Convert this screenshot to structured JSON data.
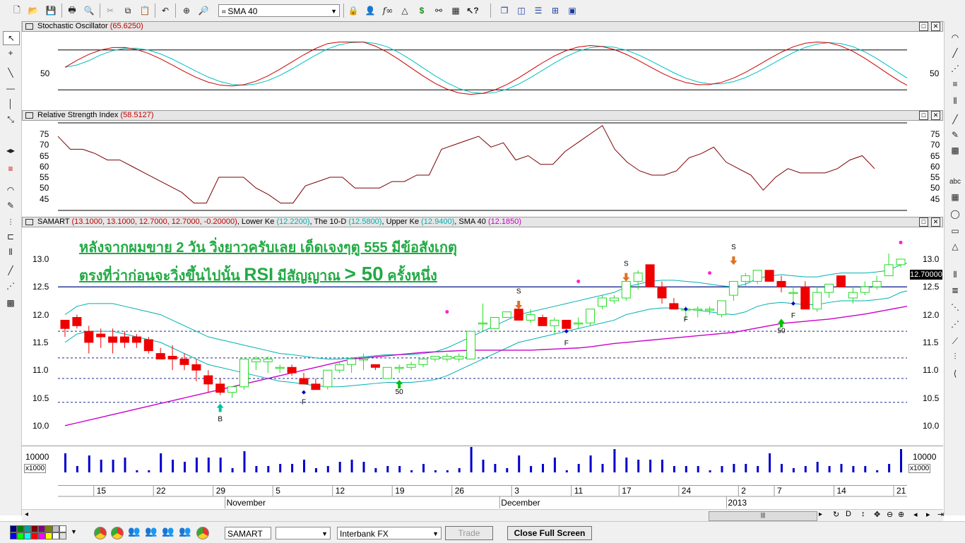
{
  "toolbar": {
    "indicator_select": "SMA 40",
    "icons": [
      "new-icon",
      "open-icon",
      "save-icon",
      "print-icon",
      "print-preview-icon",
      "cut-icon",
      "copy-icon",
      "paste-icon",
      "undo-icon",
      "crosshair-icon",
      "zoom-icon",
      "lock-icon",
      "person-icon",
      "function-icon",
      "triangle-icon",
      "dollar-icon",
      "binoculars-icon",
      "chart-settings-icon",
      "help-icon",
      "window-icon",
      "tile-vertical-icon",
      "tile-horizontal-icon",
      "tile-grid-icon",
      "layout-icon"
    ]
  },
  "stochastic": {
    "title": "Stochastic Oscillator",
    "value": "(65.6250)",
    "axis_label": "50"
  },
  "rsi": {
    "title": "Relative Strength Index",
    "value": "(58.5127)",
    "ticks": [
      "75",
      "70",
      "65",
      "60",
      "55",
      "50",
      "45"
    ],
    "values": [
      74,
      68,
      68,
      66,
      63,
      63,
      60,
      57,
      54,
      51,
      48,
      43,
      43,
      55,
      55,
      55,
      50,
      47,
      43,
      43,
      51,
      53,
      55,
      55,
      50,
      50,
      50,
      53,
      53,
      56,
      56,
      68,
      70,
      72,
      74,
      69,
      71,
      63,
      65,
      61,
      61,
      67,
      71,
      75,
      79,
      68,
      62,
      58,
      56,
      56,
      58,
      64,
      66,
      69,
      62,
      59,
      56,
      49,
      55,
      59,
      57,
      57,
      57,
      59,
      63,
      65,
      59
    ]
  },
  "price": {
    "title": "SAMART",
    "ohlc": "(13.1000, 13.1000, 12.7000, 12.7000, -0.20000)",
    "lower_label": "Lower Ke",
    "lower_value": "(12.2200)",
    "tend_label": "The 10-D",
    "tend_value": "(12.5800)",
    "upper_label": "Upper Ke",
    "upper_value": "(12.9400)",
    "sma_label": "SMA 40",
    "sma_value": "(12.1850)",
    "annotation_line1": "หลังจากผมขาย 2 วัน วิ่งยาวครับเลย เด็ดเจงๆตู 555 มีข้อสังเกตุ",
    "annotation_line2_prefix": "ตรงที่ว่าก่อนจะวิ่งขึ้นไปนั้น ",
    "annotation_line2_rsi": "RSI",
    "annotation_line2_middle": " มีสัญญาณ ",
    "annotation_line2_big": "> 50",
    "annotation_line2_suffix": " ครั้งหนึ่ง",
    "price_ticks": [
      "13.0",
      "12.5",
      "12.0",
      "11.5",
      "11.0",
      "10.5",
      "10.0"
    ],
    "last_price": "12.70000",
    "marker_labels": {
      "b": "B",
      "f": "F",
      "s": "S",
      "fifty": "50"
    },
    "candles": [
      [
        11.9,
        11.9,
        11.6,
        11.75
      ],
      [
        11.95,
        12.0,
        11.75,
        11.8
      ],
      [
        11.7,
        11.8,
        11.3,
        11.5
      ],
      [
        11.65,
        11.75,
        11.4,
        11.6
      ],
      [
        11.6,
        11.75,
        11.3,
        11.5
      ],
      [
        11.6,
        11.7,
        11.4,
        11.5
      ],
      [
        11.6,
        11.65,
        11.4,
        11.5
      ],
      [
        11.55,
        11.6,
        11.3,
        11.35
      ],
      [
        11.3,
        11.4,
        11.2,
        11.2
      ],
      [
        11.25,
        11.45,
        11.0,
        11.2
      ],
      [
        11.2,
        11.3,
        11.0,
        11.1
      ],
      [
        11.1,
        11.2,
        10.8,
        11.0
      ],
      [
        10.9,
        11.0,
        10.6,
        10.75
      ],
      [
        10.75,
        10.85,
        10.55,
        10.6
      ],
      [
        10.6,
        10.7,
        10.5,
        10.7
      ],
      [
        10.7,
        11.2,
        10.65,
        11.2
      ],
      [
        11.15,
        11.25,
        11.0,
        11.2
      ],
      [
        11.15,
        11.25,
        10.95,
        11.2
      ],
      [
        11.05,
        11.1,
        10.95,
        11.05
      ],
      [
        11.05,
        11.1,
        10.9,
        10.95
      ],
      [
        10.85,
        10.95,
        10.75,
        10.75
      ],
      [
        10.75,
        10.85,
        10.65,
        10.65
      ],
      [
        10.7,
        11.0,
        10.65,
        11.0
      ],
      [
        11.0,
        11.15,
        10.95,
        11.1
      ],
      [
        11.1,
        11.2,
        10.95,
        11.2
      ],
      [
        11.2,
        11.3,
        11.0,
        11.2
      ],
      [
        11.1,
        11.1,
        11.0,
        11.05
      ],
      [
        10.85,
        11.05,
        10.85,
        11.05
      ],
      [
        11.05,
        11.1,
        10.95,
        11.05
      ],
      [
        11.05,
        11.15,
        11.0,
        11.1
      ],
      [
        11.1,
        11.2,
        11.05,
        11.2
      ],
      [
        11.2,
        11.25,
        11.15,
        11.25
      ],
      [
        11.2,
        11.3,
        11.15,
        11.25
      ],
      [
        11.2,
        11.3,
        11.15,
        11.25
      ],
      [
        11.2,
        11.7,
        11.2,
        11.7
      ],
      [
        11.85,
        12.2,
        11.7,
        11.85
      ],
      [
        11.75,
        11.95,
        11.75,
        11.95
      ],
      [
        11.95,
        12.05,
        11.95,
        12.05
      ],
      [
        12.1,
        12.1,
        11.9,
        11.9
      ],
      [
        11.9,
        12.1,
        11.85,
        12.0
      ],
      [
        11.95,
        12.0,
        11.8,
        11.8
      ],
      [
        11.8,
        11.95,
        11.65,
        11.9
      ],
      [
        11.9,
        11.9,
        11.75,
        11.75
      ],
      [
        11.85,
        11.95,
        11.75,
        11.85
      ],
      [
        11.85,
        12.1,
        11.8,
        12.1
      ],
      [
        12.15,
        12.35,
        12.1,
        12.3
      ],
      [
        12.25,
        12.35,
        12.2,
        12.3
      ],
      [
        12.3,
        12.6,
        12.25,
        12.6
      ],
      [
        12.6,
        12.8,
        12.45,
        12.75
      ],
      [
        12.9,
        12.9,
        12.5,
        12.5
      ],
      [
        12.5,
        12.6,
        12.2,
        12.3
      ],
      [
        12.2,
        12.3,
        12.1,
        12.1
      ],
      [
        12.1,
        12.15,
        11.9,
        12.1
      ],
      [
        12.1,
        12.15,
        11.95,
        12.1
      ],
      [
        12.1,
        12.15,
        12.0,
        12.1
      ],
      [
        12.0,
        12.25,
        11.95,
        12.25
      ],
      [
        12.35,
        12.6,
        12.25,
        12.6
      ],
      [
        12.6,
        12.75,
        12.5,
        12.7
      ],
      [
        12.6,
        12.8,
        12.55,
        12.8
      ],
      [
        12.8,
        12.8,
        12.6,
        12.6
      ],
      [
        12.6,
        12.7,
        12.4,
        12.5
      ],
      [
        12.4,
        12.5,
        12.2,
        12.4
      ],
      [
        12.5,
        12.6,
        12.1,
        12.1
      ],
      [
        12.1,
        12.5,
        12.05,
        12.4
      ],
      [
        12.4,
        12.55,
        12.3,
        12.55
      ],
      [
        12.7,
        12.7,
        12.5,
        12.5
      ],
      [
        12.3,
        12.5,
        12.2,
        12.4
      ],
      [
        12.4,
        12.6,
        12.35,
        12.5
      ],
      [
        12.5,
        12.7,
        12.45,
        12.6
      ],
      [
        12.7,
        13.1,
        12.7,
        12.9
      ],
      [
        12.9,
        13.0,
        12.85,
        13.0
      ],
      [
        13.1,
        13.1,
        12.7,
        12.7
      ]
    ],
    "sma40": [
      10.0,
      10.05,
      10.1,
      10.15,
      10.2,
      10.25,
      10.3,
      10.35,
      10.4,
      10.45,
      10.5,
      10.55,
      10.6,
      10.65,
      10.7,
      10.75,
      10.8,
      10.85,
      10.9,
      10.95,
      11.0,
      11.05,
      11.1,
      11.15,
      11.2,
      11.22,
      11.24,
      11.26,
      11.28,
      11.3,
      11.32,
      11.33,
      11.34,
      11.35,
      11.36,
      11.36,
      11.36,
      11.36,
      11.36,
      11.36,
      11.37,
      11.38,
      11.39,
      11.4,
      11.42,
      11.45,
      11.48,
      11.5,
      11.52,
      11.54,
      11.56,
      11.58,
      11.6,
      11.62,
      11.64,
      11.66,
      11.68,
      11.72,
      11.76,
      11.8,
      11.84,
      11.86,
      11.88,
      11.9,
      11.92,
      11.95,
      11.98,
      12.01,
      12.05,
      12.09,
      12.13,
      12.17
    ],
    "upper": [
      12.0,
      12.15,
      12.2,
      12.2,
      12.2,
      12.15,
      12.1,
      12.05,
      12.0,
      11.9,
      11.8,
      11.7,
      11.6,
      11.55,
      11.5,
      11.45,
      11.4,
      11.35,
      11.3,
      11.28,
      11.25,
      11.22,
      11.2,
      11.2,
      11.22,
      11.24,
      11.26,
      11.28,
      11.28,
      11.28,
      11.3,
      11.33,
      11.4,
      11.5,
      11.6,
      11.7,
      11.8,
      11.9,
      12.0,
      12.05,
      12.1,
      12.15,
      12.2,
      12.25,
      12.3,
      12.35,
      12.4,
      12.5,
      12.55,
      12.6,
      12.62,
      12.62,
      12.6,
      12.58,
      12.55,
      12.52,
      12.5,
      12.55,
      12.65,
      12.7,
      12.72,
      12.7,
      12.68,
      12.68,
      12.72,
      12.75,
      12.75,
      12.75,
      12.77,
      12.8,
      12.9,
      12.95
    ],
    "lower": [
      11.5,
      11.65,
      11.7,
      11.7,
      11.7,
      11.65,
      11.6,
      11.55,
      11.5,
      11.4,
      11.3,
      11.2,
      11.1,
      11.05,
      11.0,
      10.95,
      10.9,
      10.85,
      10.8,
      10.78,
      10.75,
      10.72,
      10.7,
      10.7,
      10.72,
      10.74,
      10.76,
      10.78,
      10.78,
      10.78,
      10.8,
      10.83,
      10.9,
      11.0,
      11.1,
      11.2,
      11.3,
      11.4,
      11.5,
      11.55,
      11.6,
      11.65,
      11.7,
      11.75,
      11.8,
      11.85,
      11.9,
      12.0,
      12.05,
      12.1,
      12.12,
      12.12,
      12.1,
      12.08,
      12.05,
      12.02,
      12.0,
      12.05,
      12.15,
      12.2,
      12.22,
      12.2,
      12.18,
      12.18,
      12.22,
      12.25,
      12.25,
      12.25,
      12.27,
      12.3,
      12.4,
      12.45
    ],
    "hlines": [
      11.7,
      11.22,
      10.85,
      10.42
    ]
  },
  "volume": {
    "tick": "10000",
    "unit": "x1000",
    "values": [
      9,
      3,
      8,
      6,
      6,
      7,
      1,
      1,
      9,
      6,
      5,
      7,
      7,
      7,
      2,
      10,
      3,
      3,
      4,
      4,
      6,
      2,
      3,
      5,
      6,
      5,
      2,
      3,
      3,
      1,
      4,
      1,
      1,
      2,
      12,
      6,
      4,
      2,
      8,
      3,
      4,
      7,
      1,
      4,
      8,
      4,
      11,
      7,
      6,
      6,
      6,
      3,
      3,
      3,
      1,
      3,
      4,
      4,
      3,
      9,
      4,
      2,
      3,
      5,
      3,
      4,
      3,
      3,
      1,
      4,
      11,
      4,
      2
    ]
  },
  "dates": {
    "days": [
      "15",
      "22",
      "29",
      "5",
      "12",
      "19",
      "26",
      "3",
      "11",
      "17",
      "24",
      "2",
      "7",
      "14",
      "21"
    ],
    "months": [
      "November",
      "December",
      "2013"
    ]
  },
  "statusbar": {
    "symbol": "SAMART",
    "empty_select": "",
    "feed": "Interbank FX",
    "trade": "Trade",
    "close_full_screen": "Close Full Screen"
  },
  "colors": {
    "bull": "#22dd22",
    "bear": "#ee0000",
    "sma": "#cc00cc",
    "band": "#00b0b0",
    "stoch_k": "#cc0000",
    "stoch_d": "#00c0c0",
    "annotation": "#22aa44",
    "volume": "#0000cc"
  }
}
